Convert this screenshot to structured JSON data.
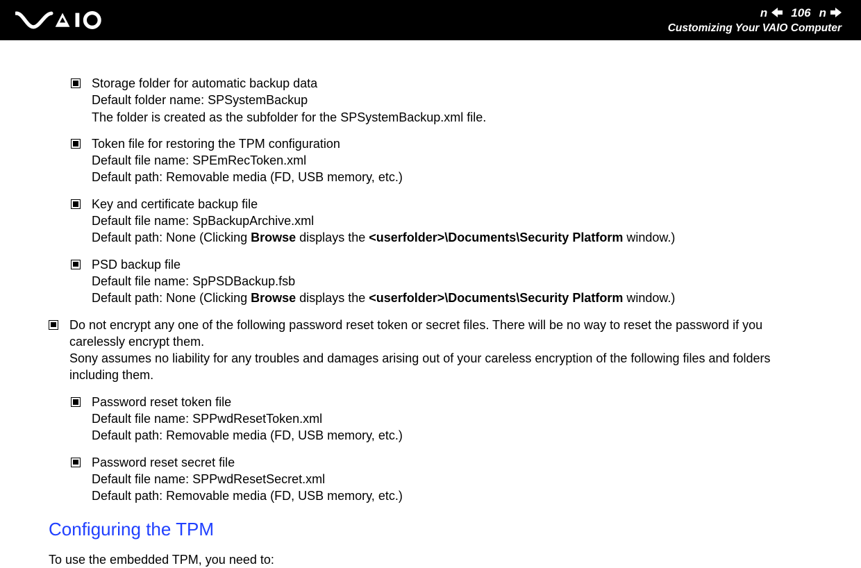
{
  "header": {
    "page_number": "106",
    "breadcrumb": "Customizing Your VAIO Computer",
    "n_letter": "n",
    "logo_alt": "VAIO"
  },
  "items_nested_a": [
    {
      "title": "Storage folder for automatic backup data",
      "line2": "Default folder name: SPSystemBackup",
      "line3": "The folder is created as the subfolder for the SPSystemBackup.xml file."
    },
    {
      "title": "Token file for restoring the TPM configuration",
      "line2": "Default file name: SPEmRecToken.xml",
      "line3": "Default path: Removable media (FD, USB memory, etc.)"
    },
    {
      "title": "Key and certificate backup file",
      "line2": "Default file name: SpBackupArchive.xml",
      "line3_pre": "Default path: None (Clicking ",
      "line3_b1": "Browse",
      "line3_mid": " displays the ",
      "line3_b2": "<userfolder>\\Documents\\Security Platform",
      "line3_post": " window.)"
    },
    {
      "title": "PSD backup file",
      "line2": "Default file name: SpPSDBackup.fsb",
      "line3_pre": "Default path: None (Clicking ",
      "line3_b1": "Browse",
      "line3_mid": " displays the ",
      "line3_b2": "<userfolder>\\Documents\\Security Platform",
      "line3_post": " window.)"
    }
  ],
  "warning": {
    "line1": "Do not encrypt any one of the following password reset token or secret files. There will be no way to reset the password if you carelessly encrypt them.",
    "line2": "Sony assumes no liability for any troubles and damages arising out of your careless encryption of the following files and folders including them."
  },
  "items_nested_b": [
    {
      "title": "Password reset token file",
      "line2": "Default file name: SPPwdResetToken.xml",
      "line3": "Default path: Removable media (FD, USB memory, etc.)"
    },
    {
      "title": "Password reset secret file",
      "line2": "Default file name: SPPwdResetSecret.xml",
      "line3": "Default path: Removable media (FD, USB memory, etc.)"
    }
  ],
  "section_heading": "Configuring the TPM",
  "closing_para": "To use the embedded TPM, you need to:"
}
